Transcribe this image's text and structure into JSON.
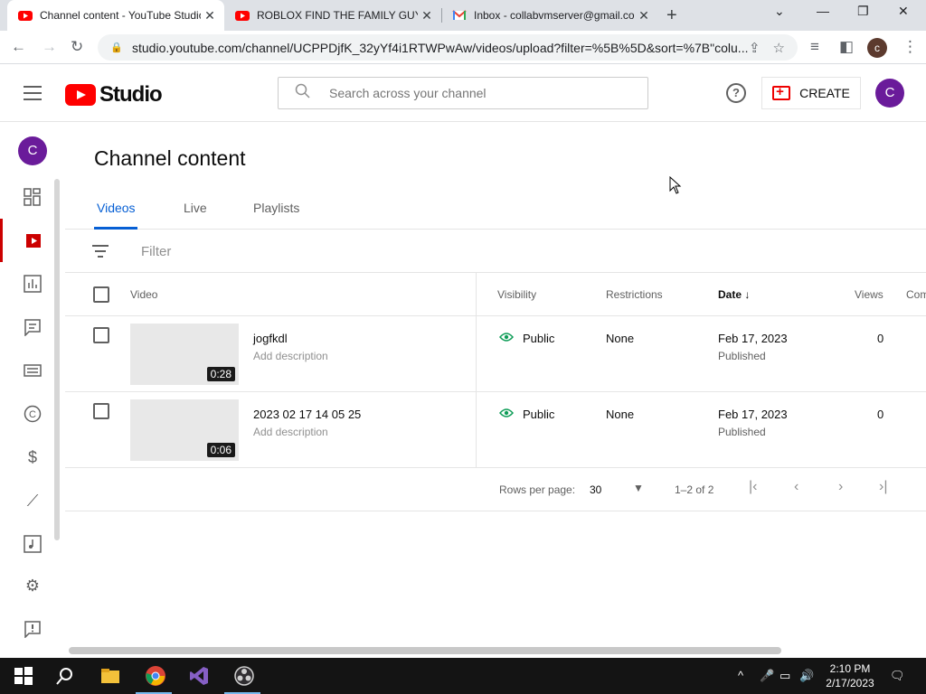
{
  "browser": {
    "tabs": [
      {
        "title": "Channel content - YouTube Studio",
        "active": true
      },
      {
        "title": "ROBLOX FIND THE FAMILY GUY...",
        "active": false
      },
      {
        "title": "Inbox - collabvmserver@gmail.com",
        "active": false
      }
    ],
    "url": "studio.youtube.com/channel/UCPPDjfK_32yYf4i1RTWPwAw/videos/upload?filter=%5B%5D&sort=%7B\"colu...",
    "profile_initial": "c"
  },
  "header": {
    "logo_text": "Studio",
    "search_placeholder": "Search across your channel",
    "create_label": "CREATE",
    "avatar_initial": "C"
  },
  "sidebar": {
    "avatar_initial": "C",
    "items": [
      {
        "name": "dashboard"
      },
      {
        "name": "content",
        "active": true
      },
      {
        "name": "analytics"
      },
      {
        "name": "comments"
      },
      {
        "name": "subtitles"
      },
      {
        "name": "copyright"
      },
      {
        "name": "earn"
      },
      {
        "name": "customization"
      },
      {
        "name": "audio-library"
      },
      {
        "name": "settings"
      },
      {
        "name": "send-feedback"
      }
    ]
  },
  "main": {
    "title": "Channel content",
    "tabs": [
      {
        "label": "Videos",
        "active": true
      },
      {
        "label": "Live",
        "active": false
      },
      {
        "label": "Playlists",
        "active": false
      }
    ],
    "filter_placeholder": "Filter",
    "columns": {
      "video": "Video",
      "visibility": "Visibility",
      "restrictions": "Restrictions",
      "date": "Date",
      "views": "Views",
      "comments": "Com"
    },
    "rows": [
      {
        "title": "jogfkdl",
        "description": "Add description",
        "duration": "0:28",
        "visibility": "Public",
        "restrictions": "None",
        "date": "Feb 17, 2023",
        "date_status": "Published",
        "views": "0"
      },
      {
        "title": "2023 02 17 14 05 25",
        "description": "Add description",
        "duration": "0:06",
        "visibility": "Public",
        "restrictions": "None",
        "date": "Feb 17, 2023",
        "date_status": "Published",
        "views": "0"
      }
    ],
    "pagination": {
      "rows_per_page_label": "Rows per page:",
      "rows_per_page": "30",
      "range": "1–2 of 2"
    }
  },
  "taskbar": {
    "time": "2:10 PM",
    "date": "2/17/2023"
  },
  "colors": {
    "accent_blue": "#065fd4",
    "brand_red": "#ff0000",
    "avatar_purple": "#6a1b9a",
    "visibility_green": "#0f9d58"
  }
}
